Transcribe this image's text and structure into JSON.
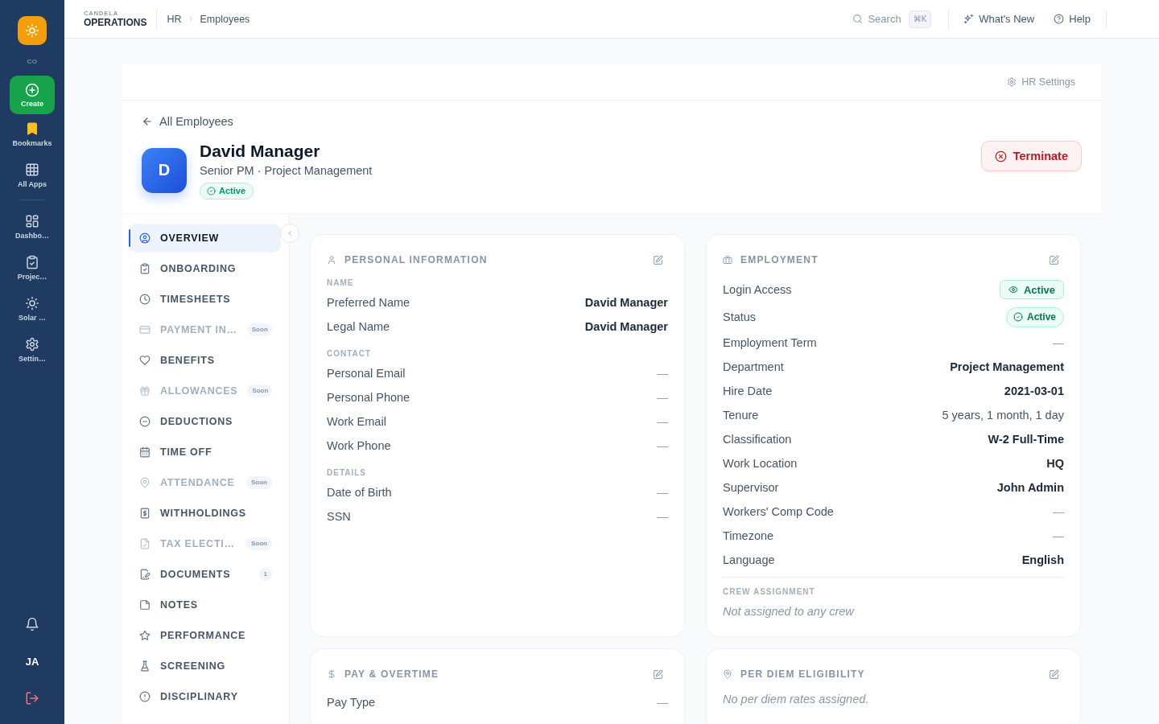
{
  "sidebar": {
    "logo_caption": "CO",
    "create": "Create",
    "top_items": [
      "Bookmarks",
      "All Apps"
    ],
    "app_items": [
      "Dashbo…",
      "Projec…",
      "Solar …",
      "Settin…"
    ],
    "user_initials": "JA"
  },
  "topbar": {
    "brand_overline": "CANDELA",
    "brand_name": "OPERATIONS",
    "breadcrumb": [
      "HR",
      "Employees"
    ],
    "search": {
      "label": "Search",
      "shortcut": "⌘K"
    },
    "links": [
      "What's New",
      "Help"
    ]
  },
  "header": {
    "settings_link": "HR Settings",
    "back_link": "All Employees",
    "employee": {
      "initial": "D",
      "name": "David Manager",
      "subtitle": "Senior PM · Project Management",
      "status": "Active"
    },
    "terminate_button": "Terminate"
  },
  "nav": {
    "items": [
      {
        "label": "OVERVIEW",
        "selected": true,
        "disabled": false
      },
      {
        "label": "ONBOARDING",
        "selected": false,
        "disabled": false
      },
      {
        "label": "TIMESHEETS",
        "selected": false,
        "disabled": false
      },
      {
        "label": "PAYMENT IN…",
        "selected": false,
        "disabled": true,
        "badge": "Soon"
      },
      {
        "label": "BENEFITS",
        "selected": false,
        "disabled": false
      },
      {
        "label": "ALLOWANCES",
        "selected": false,
        "disabled": true,
        "badge": "Soon"
      },
      {
        "label": "DEDUCTIONS",
        "selected": false,
        "disabled": false
      },
      {
        "label": "TIME OFF",
        "selected": false,
        "disabled": false
      },
      {
        "label": "ATTENDANCE",
        "selected": false,
        "disabled": true,
        "badge": "Soon"
      },
      {
        "label": "WITHHOLDINGS",
        "selected": false,
        "disabled": false
      },
      {
        "label": "TAX ELECTI…",
        "selected": false,
        "disabled": true,
        "badge": "Soon"
      },
      {
        "label": "DOCUMENTS",
        "selected": false,
        "disabled": false,
        "badge": "1"
      },
      {
        "label": "NOTES",
        "selected": false,
        "disabled": false
      },
      {
        "label": "PERFORMANCE",
        "selected": false,
        "disabled": false
      },
      {
        "label": "SCREENING",
        "selected": false,
        "disabled": false
      },
      {
        "label": "DISCIPLINARY",
        "selected": false,
        "disabled": false
      }
    ]
  },
  "cards": [
    {
      "title": "PERSONAL INFORMATION",
      "sections": [
        {
          "label": "NAME",
          "rows": [
            {
              "label": "Preferred Name",
              "value": "David Manager",
              "kind": "strong"
            },
            {
              "label": "Legal Name",
              "value": "David Manager",
              "kind": "strong"
            }
          ]
        },
        {
          "label": "CONTACT",
          "rows": [
            {
              "label": "Personal Email",
              "value": "—",
              "kind": "empty"
            },
            {
              "label": "Personal Phone",
              "value": "—",
              "kind": "empty"
            },
            {
              "label": "Work Email",
              "value": "—",
              "kind": "empty"
            },
            {
              "label": "Work Phone",
              "value": "—",
              "kind": "empty"
            }
          ]
        },
        {
          "label": "DETAILS",
          "rows": [
            {
              "label": "Date of Birth",
              "value": "—",
              "kind": "empty"
            },
            {
              "label": "SSN",
              "value": "—",
              "kind": "empty"
            }
          ]
        }
      ]
    },
    {
      "title": "EMPLOYMENT",
      "sections": [
        {
          "rows": [
            {
              "label": "Login Access",
              "value": "Active",
              "kind": "access_badge"
            },
            {
              "label": "Status",
              "value": "Active",
              "kind": "status_badge"
            },
            {
              "label": "Employment Term",
              "value": "—",
              "kind": "empty"
            },
            {
              "label": "Department",
              "value": "Project Management",
              "kind": "strong"
            },
            {
              "label": "Hire Date",
              "value": "2021-03-01",
              "kind": "strong"
            },
            {
              "label": "Tenure",
              "value": "5 years, 1 month, 1 day",
              "kind": "plain"
            },
            {
              "label": "Classification",
              "value": "W-2 Full-Time",
              "kind": "strong"
            },
            {
              "label": "Work Location",
              "value": "HQ",
              "kind": "strong"
            },
            {
              "label": "Supervisor",
              "value": "John Admin",
              "kind": "strong"
            },
            {
              "label": "Workers' Comp Code",
              "value": "—",
              "kind": "empty"
            },
            {
              "label": "Timezone",
              "value": "—",
              "kind": "empty"
            },
            {
              "label": "Language",
              "value": "English",
              "kind": "strong"
            }
          ]
        },
        {
          "label": "CREW ASSIGNMENT",
          "divider": true,
          "note": "Not assigned to any crew"
        }
      ]
    },
    {
      "title": "PAY & OVERTIME",
      "sections": [
        {
          "rows": [
            {
              "label": "Pay Type",
              "value": "—",
              "kind": "empty"
            }
          ]
        }
      ]
    },
    {
      "title": "PER DIEM ELIGIBILITY",
      "sections": [
        {
          "note": "No per diem rates assigned."
        }
      ]
    }
  ]
}
